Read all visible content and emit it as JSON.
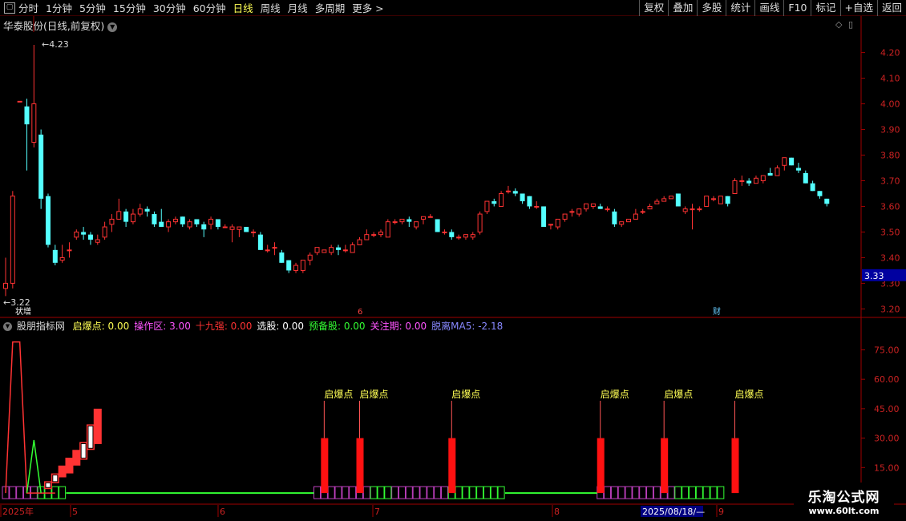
{
  "toolbar": {
    "periods": [
      "分时",
      "1分钟",
      "5分钟",
      "15分钟",
      "30分钟",
      "60分钟",
      "日线",
      "周线",
      "月线",
      "多周期",
      "更多 >"
    ],
    "active_period": "日线",
    "right_buttons": [
      "复权",
      "叠加",
      "多股",
      "统计",
      "画线",
      "F10",
      "标记",
      "+自选",
      "返回"
    ]
  },
  "stock": {
    "title": "华泰股份(日线,前复权)"
  },
  "indicator": {
    "name": "股朋指标网",
    "legend": [
      {
        "label": "启爆点:",
        "value": "0.00",
        "color": "#ffff55"
      },
      {
        "label": "操作区:",
        "value": "3.00",
        "color": "#ff55ff"
      },
      {
        "label": "十九强:",
        "value": "0.00",
        "color": "#ff3333"
      },
      {
        "label": "选股:",
        "value": "0.00",
        "color": "#ffffff"
      },
      {
        "label": "预备股:",
        "value": "0.00",
        "color": "#33ff33"
      },
      {
        "label": "关注期:",
        "value": "0.00",
        "color": "#ff55ff"
      },
      {
        "label": "脱离MA5:",
        "value": "-2.18",
        "color": "#8888ff"
      }
    ],
    "signal_label": "启爆点"
  },
  "price_axis": {
    "ticks": [
      "4.20",
      "4.10",
      "4.00",
      "3.90",
      "3.80",
      "3.70",
      "3.60",
      "3.50",
      "3.40",
      "3.30",
      "3.20"
    ],
    "current_price": "3.33"
  },
  "ind_axis": {
    "ticks": [
      "75.00",
      "60.00",
      "45.00",
      "30.00",
      "15.00"
    ]
  },
  "annotations": {
    "high_label": "4.23",
    "low_label": "3.22",
    "event_left": "状增",
    "event_mid": "6",
    "event_right": "财"
  },
  "date_axis": {
    "labels": [
      "2025年",
      "5",
      "6",
      "7",
      "8",
      "9"
    ],
    "cursor_date": "2025/08/18/—"
  },
  "watermark": {
    "line1": "乐淘公式网",
    "line2": "www.60lt.com"
  },
  "colors": {
    "up": "#ff3333",
    "down": "#54ffff",
    "axis": "#a00000",
    "purple": "#c040c0",
    "green": "#33ff33",
    "yellow": "#ffff55"
  },
  "chart_data": {
    "type": "candlestick",
    "ylim": [
      3.17,
      4.28
    ],
    "candles": [
      {
        "o": 3.28,
        "h": 3.4,
        "l": 3.25,
        "c": 3.3
      },
      {
        "o": 3.3,
        "h": 3.66,
        "l": 3.28,
        "c": 3.64
      },
      {
        "o": 4.01,
        "h": 4.01,
        "l": 4.01,
        "c": 4.01
      },
      {
        "o": 3.99,
        "h": 4.02,
        "l": 3.74,
        "c": 3.92
      },
      {
        "o": 3.85,
        "h": 4.23,
        "l": 3.83,
        "c": 4.0
      },
      {
        "o": 3.88,
        "h": 3.9,
        "l": 3.59,
        "c": 3.63
      },
      {
        "o": 3.64,
        "h": 3.65,
        "l": 3.44,
        "c": 3.45
      },
      {
        "o": 3.43,
        "h": 3.45,
        "l": 3.37,
        "c": 3.38
      },
      {
        "o": 3.39,
        "h": 3.45,
        "l": 3.38,
        "c": 3.4
      },
      {
        "o": 3.43,
        "h": 3.46,
        "l": 3.4,
        "c": 3.43
      },
      {
        "o": 3.48,
        "h": 3.51,
        "l": 3.47,
        "c": 3.5
      },
      {
        "o": 3.5,
        "h": 3.52,
        "l": 3.47,
        "c": 3.49
      },
      {
        "o": 3.49,
        "h": 3.5,
        "l": 3.45,
        "c": 3.47
      },
      {
        "o": 3.46,
        "h": 3.49,
        "l": 3.45,
        "c": 3.47
      },
      {
        "o": 3.48,
        "h": 3.54,
        "l": 3.47,
        "c": 3.52
      },
      {
        "o": 3.53,
        "h": 3.57,
        "l": 3.5,
        "c": 3.55
      },
      {
        "o": 3.55,
        "h": 3.63,
        "l": 3.55,
        "c": 3.58
      },
      {
        "o": 3.58,
        "h": 3.59,
        "l": 3.52,
        "c": 3.54
      },
      {
        "o": 3.54,
        "h": 3.59,
        "l": 3.53,
        "c": 3.57
      },
      {
        "o": 3.57,
        "h": 3.61,
        "l": 3.56,
        "c": 3.59
      },
      {
        "o": 3.59,
        "h": 3.6,
        "l": 3.56,
        "c": 3.58
      },
      {
        "o": 3.57,
        "h": 3.58,
        "l": 3.52,
        "c": 3.53
      },
      {
        "o": 3.54,
        "h": 3.59,
        "l": 3.52,
        "c": 3.52
      },
      {
        "o": 3.52,
        "h": 3.55,
        "l": 3.5,
        "c": 3.54
      },
      {
        "o": 3.54,
        "h": 3.56,
        "l": 3.53,
        "c": 3.55
      },
      {
        "o": 3.56,
        "h": 3.56,
        "l": 3.52,
        "c": 3.53
      },
      {
        "o": 3.52,
        "h": 3.55,
        "l": 3.51,
        "c": 3.54
      },
      {
        "o": 3.55,
        "h": 3.55,
        "l": 3.52,
        "c": 3.53
      },
      {
        "o": 3.53,
        "h": 3.54,
        "l": 3.48,
        "c": 3.51
      },
      {
        "o": 3.53,
        "h": 3.56,
        "l": 3.51,
        "c": 3.55
      },
      {
        "o": 3.55,
        "h": 3.55,
        "l": 3.51,
        "c": 3.52
      },
      {
        "o": 3.52,
        "h": 3.53,
        "l": 3.52,
        "c": 3.52
      },
      {
        "o": 3.51,
        "h": 3.53,
        "l": 3.46,
        "c": 3.52
      },
      {
        "o": 3.51,
        "h": 3.52,
        "l": 3.48,
        "c": 3.52
      },
      {
        "o": 3.52,
        "h": 3.52,
        "l": 3.5,
        "c": 3.5
      },
      {
        "o": 3.5,
        "h": 3.51,
        "l": 3.48,
        "c": 3.5
      },
      {
        "o": 3.49,
        "h": 3.5,
        "l": 3.43,
        "c": 3.43
      },
      {
        "o": 3.43,
        "h": 3.45,
        "l": 3.42,
        "c": 3.43
      },
      {
        "o": 3.44,
        "h": 3.46,
        "l": 3.41,
        "c": 3.44
      },
      {
        "o": 3.42,
        "h": 3.43,
        "l": 3.38,
        "c": 3.38
      },
      {
        "o": 3.39,
        "h": 3.39,
        "l": 3.34,
        "c": 3.35
      },
      {
        "o": 3.35,
        "h": 3.38,
        "l": 3.34,
        "c": 3.37
      },
      {
        "o": 3.35,
        "h": 3.39,
        "l": 3.34,
        "c": 3.39
      },
      {
        "o": 3.39,
        "h": 3.42,
        "l": 3.37,
        "c": 3.41
      },
      {
        "o": 3.42,
        "h": 3.44,
        "l": 3.41,
        "c": 3.44
      },
      {
        "o": 3.42,
        "h": 3.43,
        "l": 3.42,
        "c": 3.43
      },
      {
        "o": 3.42,
        "h": 3.45,
        "l": 3.41,
        "c": 3.44
      },
      {
        "o": 3.44,
        "h": 3.45,
        "l": 3.41,
        "c": 3.43
      },
      {
        "o": 3.43,
        "h": 3.45,
        "l": 3.42,
        "c": 3.43
      },
      {
        "o": 3.42,
        "h": 3.46,
        "l": 3.42,
        "c": 3.45
      },
      {
        "o": 3.45,
        "h": 3.48,
        "l": 3.45,
        "c": 3.47
      },
      {
        "o": 3.47,
        "h": 3.51,
        "l": 3.47,
        "c": 3.49
      },
      {
        "o": 3.49,
        "h": 3.5,
        "l": 3.48,
        "c": 3.49
      },
      {
        "o": 3.49,
        "h": 3.51,
        "l": 3.48,
        "c": 3.5
      },
      {
        "o": 3.48,
        "h": 3.55,
        "l": 3.48,
        "c": 3.54
      },
      {
        "o": 3.54,
        "h": 3.55,
        "l": 3.53,
        "c": 3.54
      },
      {
        "o": 3.54,
        "h": 3.55,
        "l": 3.53,
        "c": 3.55
      },
      {
        "o": 3.55,
        "h": 3.56,
        "l": 3.52,
        "c": 3.54
      },
      {
        "o": 3.52,
        "h": 3.54,
        "l": 3.51,
        "c": 3.54
      },
      {
        "o": 3.55,
        "h": 3.56,
        "l": 3.53,
        "c": 3.56
      },
      {
        "o": 3.56,
        "h": 3.57,
        "l": 3.56,
        "c": 3.56
      },
      {
        "o": 3.55,
        "h": 3.55,
        "l": 3.5,
        "c": 3.5
      },
      {
        "o": 3.5,
        "h": 3.51,
        "l": 3.49,
        "c": 3.5
      },
      {
        "o": 3.5,
        "h": 3.51,
        "l": 3.47,
        "c": 3.48
      },
      {
        "o": 3.48,
        "h": 3.49,
        "l": 3.47,
        "c": 3.48
      },
      {
        "o": 3.48,
        "h": 3.49,
        "l": 3.47,
        "c": 3.49
      },
      {
        "o": 3.48,
        "h": 3.5,
        "l": 3.47,
        "c": 3.49
      },
      {
        "o": 3.5,
        "h": 3.58,
        "l": 3.49,
        "c": 3.57
      },
      {
        "o": 3.58,
        "h": 3.62,
        "l": 3.57,
        "c": 3.62
      },
      {
        "o": 3.62,
        "h": 3.63,
        "l": 3.6,
        "c": 3.61
      },
      {
        "o": 3.6,
        "h": 3.66,
        "l": 3.6,
        "c": 3.65
      },
      {
        "o": 3.66,
        "h": 3.68,
        "l": 3.65,
        "c": 3.66
      },
      {
        "o": 3.66,
        "h": 3.67,
        "l": 3.64,
        "c": 3.65
      },
      {
        "o": 3.65,
        "h": 3.65,
        "l": 3.61,
        "c": 3.62
      },
      {
        "o": 3.64,
        "h": 3.64,
        "l": 3.59,
        "c": 3.6
      },
      {
        "o": 3.6,
        "h": 3.62,
        "l": 3.59,
        "c": 3.6
      },
      {
        "o": 3.6,
        "h": 3.6,
        "l": 3.52,
        "c": 3.52
      },
      {
        "o": 3.53,
        "h": 3.53,
        "l": 3.51,
        "c": 3.53
      },
      {
        "o": 3.52,
        "h": 3.55,
        "l": 3.51,
        "c": 3.55
      },
      {
        "o": 3.55,
        "h": 3.57,
        "l": 3.54,
        "c": 3.57
      },
      {
        "o": 3.58,
        "h": 3.59,
        "l": 3.56,
        "c": 3.58
      },
      {
        "o": 3.57,
        "h": 3.59,
        "l": 3.56,
        "c": 3.59
      },
      {
        "o": 3.59,
        "h": 3.61,
        "l": 3.58,
        "c": 3.61
      },
      {
        "o": 3.6,
        "h": 3.61,
        "l": 3.59,
        "c": 3.61
      },
      {
        "o": 3.6,
        "h": 3.61,
        "l": 3.59,
        "c": 3.59
      },
      {
        "o": 3.59,
        "h": 3.6,
        "l": 3.58,
        "c": 3.59
      },
      {
        "o": 3.58,
        "h": 3.59,
        "l": 3.52,
        "c": 3.53
      },
      {
        "o": 3.53,
        "h": 3.54,
        "l": 3.52,
        "c": 3.54
      },
      {
        "o": 3.54,
        "h": 3.55,
        "l": 3.54,
        "c": 3.55
      },
      {
        "o": 3.55,
        "h": 3.59,
        "l": 3.55,
        "c": 3.57
      },
      {
        "o": 3.58,
        "h": 3.59,
        "l": 3.57,
        "c": 3.58
      },
      {
        "o": 3.59,
        "h": 3.61,
        "l": 3.59,
        "c": 3.6
      },
      {
        "o": 3.61,
        "h": 3.63,
        "l": 3.61,
        "c": 3.62
      },
      {
        "o": 3.62,
        "h": 3.64,
        "l": 3.62,
        "c": 3.63
      },
      {
        "o": 3.63,
        "h": 3.64,
        "l": 3.63,
        "c": 3.64
      },
      {
        "o": 3.65,
        "h": 3.65,
        "l": 3.6,
        "c": 3.6
      },
      {
        "o": 3.58,
        "h": 3.6,
        "l": 3.57,
        "c": 3.59
      },
      {
        "o": 3.59,
        "h": 3.61,
        "l": 3.51,
        "c": 3.59
      },
      {
        "o": 3.59,
        "h": 3.6,
        "l": 3.58,
        "c": 3.59
      },
      {
        "o": 3.6,
        "h": 3.64,
        "l": 3.6,
        "c": 3.64
      },
      {
        "o": 3.63,
        "h": 3.64,
        "l": 3.62,
        "c": 3.63
      },
      {
        "o": 3.61,
        "h": 3.64,
        "l": 3.61,
        "c": 3.64
      },
      {
        "o": 3.64,
        "h": 3.64,
        "l": 3.6,
        "c": 3.61
      },
      {
        "o": 3.65,
        "h": 3.71,
        "l": 3.65,
        "c": 3.7
      },
      {
        "o": 3.7,
        "h": 3.72,
        "l": 3.68,
        "c": 3.7
      },
      {
        "o": 3.7,
        "h": 3.71,
        "l": 3.68,
        "c": 3.69
      },
      {
        "o": 3.69,
        "h": 3.72,
        "l": 3.69,
        "c": 3.71
      },
      {
        "o": 3.7,
        "h": 3.72,
        "l": 3.69,
        "c": 3.72
      },
      {
        "o": 3.73,
        "h": 3.75,
        "l": 3.72,
        "c": 3.72
      },
      {
        "o": 3.72,
        "h": 3.76,
        "l": 3.72,
        "c": 3.75
      },
      {
        "o": 3.76,
        "h": 3.79,
        "l": 3.74,
        "c": 3.79
      },
      {
        "o": 3.79,
        "h": 3.79,
        "l": 3.76,
        "c": 3.76
      },
      {
        "o": 3.75,
        "h": 3.77,
        "l": 3.73,
        "c": 3.74
      },
      {
        "o": 3.73,
        "h": 3.74,
        "l": 3.69,
        "c": 3.69
      },
      {
        "o": 3.69,
        "h": 3.7,
        "l": 3.66,
        "c": 3.66
      },
      {
        "o": 3.66,
        "h": 3.66,
        "l": 3.63,
        "c": 3.64
      },
      {
        "o": 3.63,
        "h": 3.63,
        "l": 3.6,
        "c": 3.61
      }
    ],
    "indicator": {
      "ylim": [
        0,
        85
      ],
      "markers": [
        {
          "idx": 45,
          "label": "启爆点"
        },
        {
          "idx": 50,
          "label": "启爆点"
        },
        {
          "idx": 63,
          "label": "启爆点"
        },
        {
          "idx": 84,
          "label": "启爆点"
        },
        {
          "idx": 93,
          "label": "启爆点"
        },
        {
          "idx": 103,
          "label": "启爆点"
        }
      ],
      "marker_bar": [
        2,
        30
      ],
      "red_line": [
        [
          0,
          2
        ],
        [
          1,
          79
        ],
        [
          2,
          79
        ],
        [
          3,
          2
        ],
        [
          4,
          2
        ],
        [
          5,
          2
        ],
        [
          6,
          2
        ],
        [
          7,
          2
        ]
      ],
      "green_line": [
        [
          3,
          2
        ],
        [
          4,
          29
        ],
        [
          5,
          2
        ]
      ],
      "ladder": [
        {
          "i": 6,
          "lo": 4,
          "hi": 8,
          "hollow": true
        },
        {
          "i": 7,
          "lo": 7,
          "hi": 12,
          "hollow": true
        },
        {
          "i": 8,
          "lo": 10,
          "hi": 16,
          "hollow": false
        },
        {
          "i": 9,
          "lo": 12,
          "hi": 20,
          "hollow": false
        },
        {
          "i": 10,
          "lo": 16,
          "hi": 24,
          "hollow": false
        },
        {
          "i": 11,
          "lo": 19,
          "hi": 28,
          "hollow": true
        },
        {
          "i": 12,
          "lo": 24,
          "hi": 37,
          "hollow": true
        },
        {
          "i": 13,
          "lo": 27,
          "hi": 45,
          "hollow": false
        }
      ],
      "zone_strip": {
        "purple": [
          [
            0,
            5
          ],
          [
            44,
            52
          ],
          [
            55,
            63
          ],
          [
            84,
            95
          ]
        ],
        "green": [
          [
            5,
            9
          ],
          [
            52,
            55
          ],
          [
            63,
            71
          ],
          [
            95,
            102
          ]
        ],
        "line_gaps": [
          [
            9,
            44
          ],
          [
            71,
            84
          ]
        ]
      }
    }
  }
}
